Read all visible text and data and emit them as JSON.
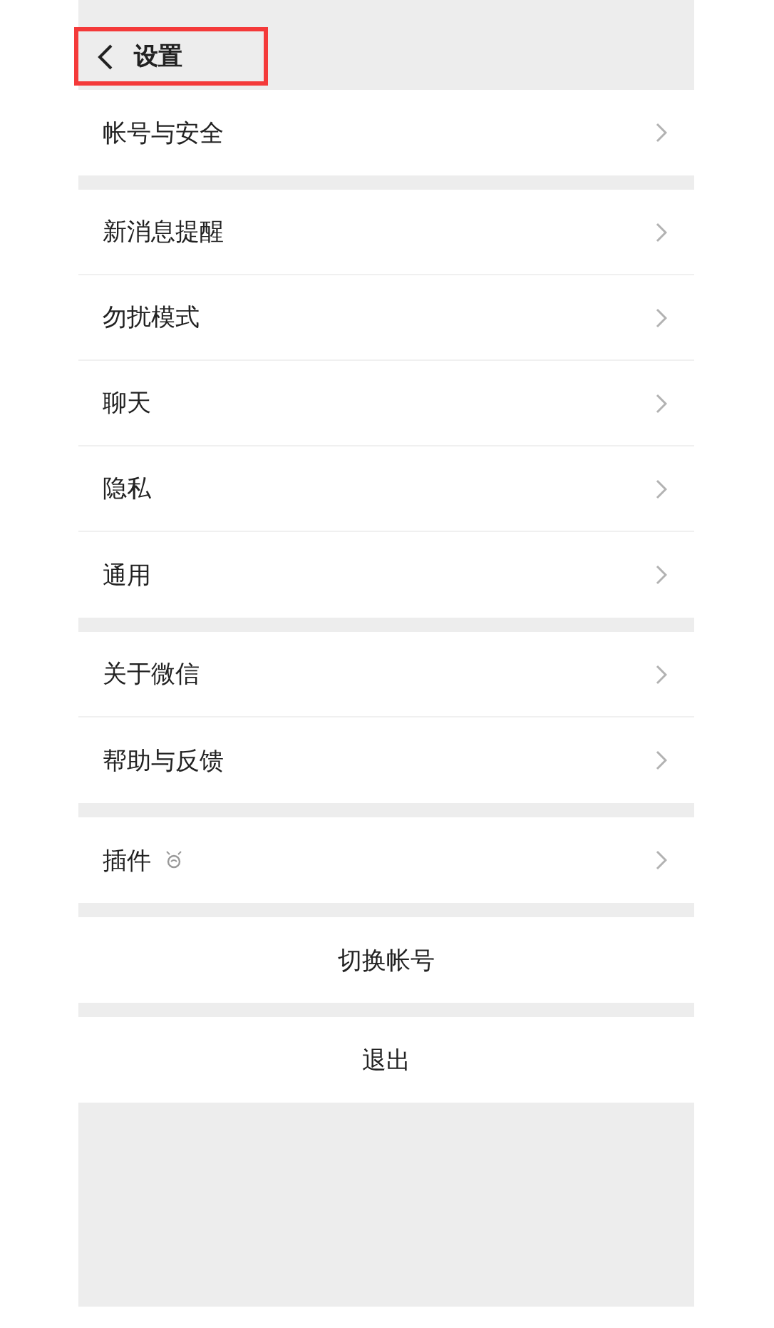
{
  "header": {
    "title": "设置",
    "highlighted": true
  },
  "groups": [
    {
      "items": [
        {
          "label": "帐号与安全",
          "kind": "row"
        }
      ]
    },
    {
      "items": [
        {
          "label": "新消息提醒",
          "kind": "row"
        },
        {
          "label": "勿扰模式",
          "kind": "row"
        },
        {
          "label": "聊天",
          "kind": "row"
        },
        {
          "label": "隐私",
          "kind": "row"
        },
        {
          "label": "通用",
          "kind": "row"
        }
      ]
    },
    {
      "items": [
        {
          "label": "关于微信",
          "kind": "row"
        },
        {
          "label": "帮助与反馈",
          "kind": "row"
        }
      ]
    },
    {
      "items": [
        {
          "label": "插件",
          "kind": "icon-row"
        }
      ]
    }
  ],
  "actions": [
    "切换帐号",
    "退出"
  ]
}
